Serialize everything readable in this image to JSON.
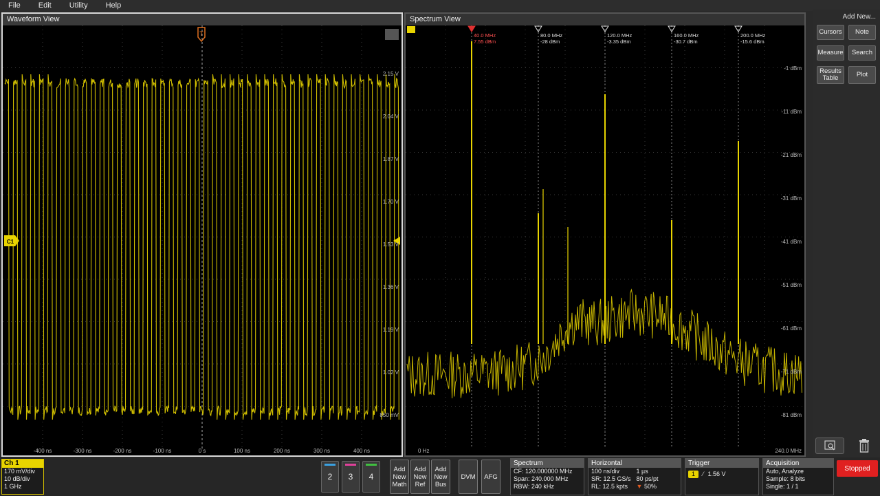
{
  "menu": [
    "File",
    "Edit",
    "Utility",
    "Help"
  ],
  "waveform": {
    "title": "Waveform View",
    "ch_marker": "C1",
    "trigger_marker": "T",
    "x_ticks": [
      "-400 ns",
      "-300 ns",
      "-200 ns",
      "-100 ns",
      "0 s",
      "100 ns",
      "200 ns",
      "300 ns",
      "400 ns"
    ],
    "y_labels": [
      "2.15 V",
      "2.04 V",
      "1.87 V",
      "1.70 V",
      "1.53 V",
      "1.36 V",
      "1.19 V",
      "1.02 V",
      "850 mV"
    ],
    "trace_color": "#e8d400"
  },
  "spectrum": {
    "title": "Spectrum View",
    "x_start": "0 Hz",
    "x_end": "240.0 MHz",
    "y_labels": [
      "-1 dBm",
      "-11 dBm",
      "-21 dBm",
      "-31 dBm",
      "-41 dBm",
      "-51 dBm",
      "-61 dBm",
      "-71 dBm",
      "-81 dBm"
    ],
    "markers": [
      {
        "freq": "40.0 MHz",
        "level": "7.55 dBm",
        "ref": true
      },
      {
        "freq": "80.0 MHz",
        "level": "-28 dBm"
      },
      {
        "freq": "120.0 MHz",
        "level": "-3.35 dBm"
      },
      {
        "freq": "160.0 MHz",
        "level": "-30.7 dBm"
      },
      {
        "freq": "200.0 MHz",
        "level": "-15.6 dBm"
      }
    ]
  },
  "right": {
    "add_new": "Add New...",
    "buttons": [
      "Cursors",
      "Note",
      "Measure",
      "Search",
      "Results Table",
      "Plot"
    ]
  },
  "bottom": {
    "ch1": {
      "title": "Ch 1",
      "lines": [
        "170 mV/div",
        "10 dB/div",
        "1 GHz"
      ]
    },
    "channels": [
      "2",
      "3",
      "4"
    ],
    "add_buttons": [
      "Add New Math",
      "Add New Ref",
      "Add New Bus",
      "DVM",
      "AFG"
    ],
    "spectrum_box": {
      "title": "Spectrum",
      "lines": [
        "CF: 120.000000 MHz",
        "Span: 240.000 MHz",
        "RBW: 240 kHz"
      ]
    },
    "horizontal_box": {
      "title": "Horizontal",
      "col1": [
        "100 ns/div",
        "SR: 12.5 GS/s",
        "RL: 12.5 kpts"
      ],
      "col2": [
        "1 µs",
        "80 ps/pt",
        "50%"
      ]
    },
    "trigger_box": {
      "title": "Trigger",
      "source": "1",
      "level": "1.56 V"
    },
    "acq_box": {
      "title": "Acquisition",
      "lines": [
        "Auto,   Analyze",
        "Sample: 8 bits",
        "Single: 1 / 1"
      ]
    },
    "stopped": "Stopped"
  }
}
